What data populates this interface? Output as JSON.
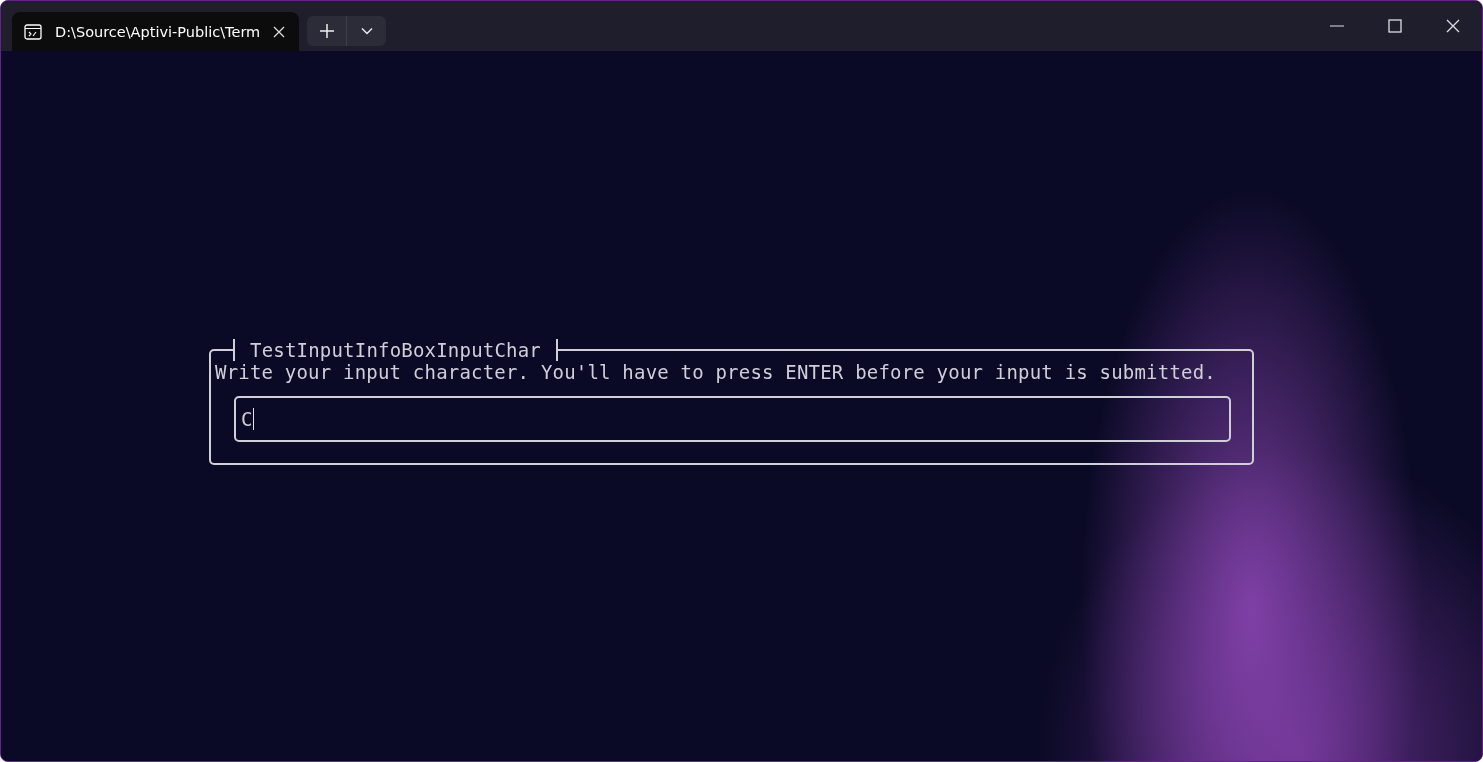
{
  "tabs": [
    {
      "title": "D:\\Source\\Aptivi-Public\\Term",
      "selected": true
    }
  ],
  "dialog": {
    "title": "TestInputInfoBoxInputChar",
    "message": "Write your input character. You'll have to press ENTER before your input is submitted.",
    "input": {
      "value": "C"
    }
  }
}
